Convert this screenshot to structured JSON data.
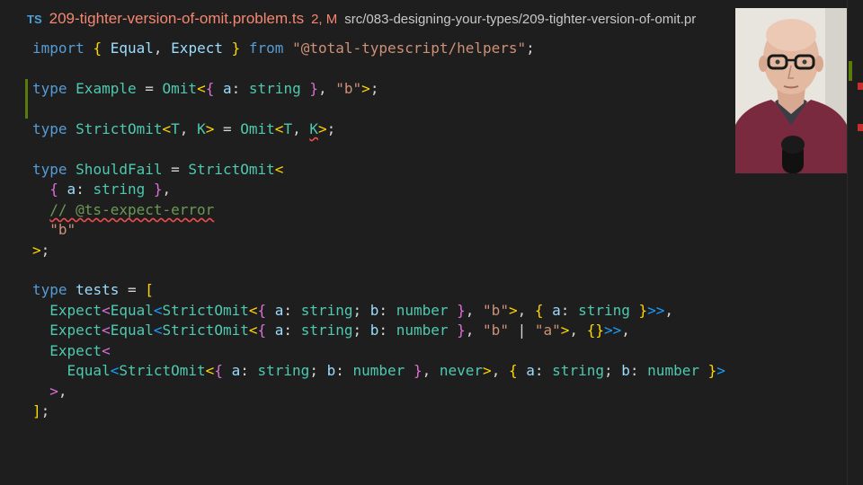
{
  "tab": {
    "icon": "TS",
    "filename": "209-tighter-version-of-omit.problem.ts",
    "status": "2, M",
    "path": "src/083-designing-your-types/209-tighter-version-of-omit.pr"
  },
  "code": {
    "l1": {
      "import": "import",
      "ob": "{",
      "equal": "Equal",
      "comma": ",",
      "expect": "Expect",
      "cb": "}",
      "from": "from",
      "module": "\"@total-typescript/helpers\"",
      "semi": ";"
    },
    "l3": {
      "type": "type",
      "name": "Example",
      "eq": "=",
      "omit": "Omit",
      "lt": "<",
      "ob": "{",
      "a": "a",
      "colon": ":",
      "string": "string",
      "cb": "}",
      "comma": ",",
      "b": "\"b\"",
      "gt": ">",
      "semi": ";"
    },
    "l5": {
      "type": "type",
      "name": "StrictOmit",
      "lt": "<",
      "T": "T",
      "comma": ",",
      "K": "K",
      "gt": ">",
      "eq": "=",
      "omit": "Omit",
      "lt2": "<",
      "T2": "T",
      "comma2": ",",
      "K2": "K",
      "gt2": ">",
      "semi": ";"
    },
    "l7": {
      "type": "type",
      "name": "ShouldFail",
      "eq": "=",
      "so": "StrictOmit",
      "lt": "<"
    },
    "l8": {
      "ob": "{",
      "a": "a",
      "colon": ":",
      "string": "string",
      "cb": "}",
      "comma": ","
    },
    "l9": {
      "comment": "// @ts-expect-error"
    },
    "l10": {
      "b": "\"b\""
    },
    "l11": {
      "gt": ">",
      "semi": ";"
    },
    "l13": {
      "type": "type",
      "name": "tests",
      "eq": "=",
      "ob": "["
    },
    "l14": {
      "expect": "Expect",
      "lt": "<",
      "equal": "Equal",
      "lt2": "<",
      "so": "StrictOmit",
      "lt3": "<",
      "ob": "{",
      "a": "a",
      "c1": ":",
      "string": "string",
      "sc": ";",
      "b": "b",
      "c2": ":",
      "number": "number",
      "cb": "}",
      "comma": ",",
      "sb": "\"b\"",
      "gt": ">",
      "comma2": ",",
      "ob2": "{",
      "a2": "a",
      "c3": ":",
      "string2": "string",
      "cb2": "}",
      "gt2": ">>",
      "comma3": ","
    },
    "l15": {
      "expect": "Expect",
      "lt": "<",
      "equal": "Equal",
      "lt2": "<",
      "so": "StrictOmit",
      "lt3": "<",
      "ob": "{",
      "a": "a",
      "c1": ":",
      "string": "string",
      "sc": ";",
      "b": "b",
      "c2": ":",
      "number": "number",
      "cb": "}",
      "comma": ",",
      "sb": "\"b\"",
      "pipe": "|",
      "sa": "\"a\"",
      "gt": ">",
      "comma2": ",",
      "empty": "{}",
      "gt2": ">>",
      "comma3": ","
    },
    "l16": {
      "expect": "Expect",
      "lt": "<"
    },
    "l17": {
      "equal": "Equal",
      "lt": "<",
      "so": "StrictOmit",
      "lt2": "<",
      "ob": "{",
      "a": "a",
      "c1": ":",
      "string": "string",
      "sc": ";",
      "b": "b",
      "c2": ":",
      "number": "number",
      "cb": "}",
      "comma": ",",
      "never": "never",
      "gt": ">",
      "comma2": ",",
      "ob2": "{",
      "a2": "a",
      "c3": ":",
      "string2": "string",
      "sc2": ";",
      "b2": "b",
      "c4": ":",
      "number2": "number",
      "cb2": "}",
      "gt2": ">"
    },
    "l18": {
      "gt": ">",
      "comma": ","
    },
    "l19": {
      "cb": "]",
      "semi": ";"
    }
  },
  "colors": {
    "modified": "#587c0c",
    "error": "#f14c4c",
    "filename": "#f48771"
  }
}
